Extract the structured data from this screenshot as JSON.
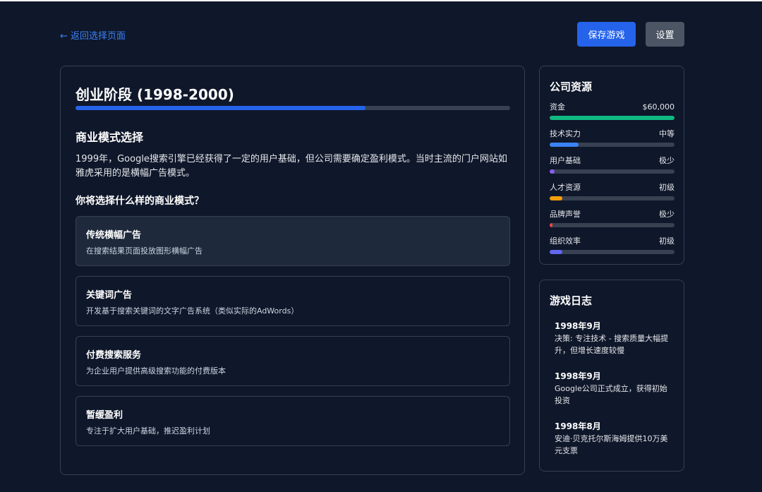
{
  "header": {
    "back_label": "← 返回选择页面",
    "save_label": "保存游戏",
    "settings_label": "设置"
  },
  "stage": {
    "title": "创业阶段 (1998-2000)",
    "progress": 0.667
  },
  "scenario": {
    "section_title": "商业模式选择",
    "description": "1999年，Google搜索引擎已经获得了一定的用户基础，但公司需要确定盈利模式。当时主流的门户网站如雅虎采用的是横幅广告模式。",
    "question": "你将选择什么样的商业模式？"
  },
  "options": [
    {
      "title": "传统横幅广告",
      "desc": "在搜索结果页面投放图形横幅广告"
    },
    {
      "title": "关键词广告",
      "desc": "开发基于搜索关键词的文字广告系统（类似实际的AdWords）"
    },
    {
      "title": "付费搜索服务",
      "desc": "为企业用户提供高级搜索功能的付费版本"
    },
    {
      "title": "暂缓盈利",
      "desc": "专注于扩大用户基础，推迟盈利计划"
    }
  ],
  "resources": {
    "title": "公司资源",
    "items": [
      {
        "label": "资金",
        "value": "$60,000",
        "level": 1.0,
        "color": "#10b981"
      },
      {
        "label": "技术实力",
        "value": "中等",
        "level": 0.23,
        "color": "#3b82f6"
      },
      {
        "label": "用户基础",
        "value": "极少",
        "level": 0.04,
        "color": "#8b5cf6"
      },
      {
        "label": "人才资源",
        "value": "初级",
        "level": 0.1,
        "color": "#f59e0b"
      },
      {
        "label": "品牌声誉",
        "value": "极少",
        "level": 0.02,
        "color": "#ef4444"
      },
      {
        "label": "组织效率",
        "value": "初级",
        "level": 0.1,
        "color": "#6366f1"
      }
    ]
  },
  "log": {
    "title": "游戏日志",
    "entries": [
      {
        "date": "1998年9月",
        "text": "决策: 专注技术 - 搜索质量大幅提升，但增长速度较慢"
      },
      {
        "date": "1998年9月",
        "text": "Google公司正式成立，获得初始投资"
      },
      {
        "date": "1998年8月",
        "text": "安迪·贝克托尔斯海姆提供10万美元支票"
      }
    ]
  }
}
